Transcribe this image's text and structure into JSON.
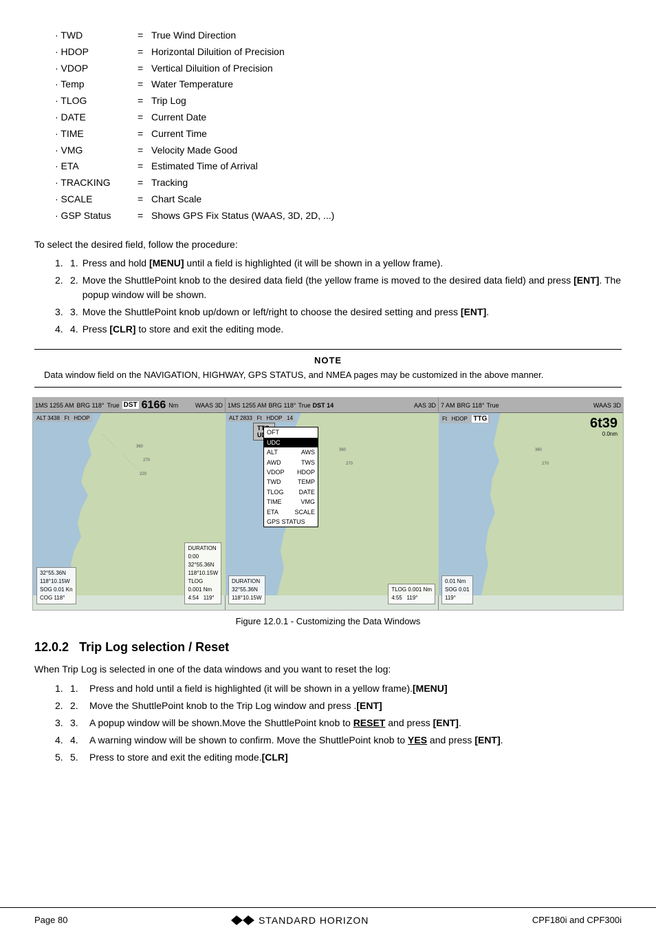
{
  "abbrevList": [
    {
      "key": "· TWD",
      "eq": "=",
      "val": "True Wind Direction"
    },
    {
      "key": "· HDOP",
      "eq": "=",
      "val": "Horizontal Diluition of Precision"
    },
    {
      "key": "· VDOP",
      "eq": "=",
      "val": "Vertical Diluition of Precision"
    },
    {
      "key": "· Temp",
      "eq": "=",
      "val": "Water Temperature"
    },
    {
      "key": "· TLOG",
      "eq": "=",
      "val": "Trip Log"
    },
    {
      "key": "· DATE",
      "eq": "=",
      "val": "Current Date"
    },
    {
      "key": "· TIME",
      "eq": "=",
      "val": "Current Time"
    },
    {
      "key": "· VMG",
      "eq": "=",
      "val": "Velocity Made Good"
    },
    {
      "key": "· ETA",
      "eq": "=",
      "val": "Estimated Time of Arrival"
    },
    {
      "key": "· TRACKING",
      "eq": "=",
      "val": "Tracking"
    },
    {
      "key": "· SCALE",
      "eq": "=",
      "val": "Chart Scale"
    },
    {
      "key": "· GSP Status",
      "eq": "=",
      "val": "Shows GPS Fix Status (WAAS, 3D, 2D, ...)"
    }
  ],
  "selectProcedureIntro": "To select the desired field, follow the procedure:",
  "selectProcedureSteps": [
    {
      "text": "Press and hold ",
      "bold": "[MENU]",
      "rest": " until a field is highlighted (it will be shown in a yellow frame)."
    },
    {
      "text": "Move the ShuttlePoint knob to the desired data field (the yellow frame is moved to the desired data field) and press ",
      "bold": "[ENT]",
      "rest": ". The popup window will be shown."
    },
    {
      "text": "Move the ShuttlePoint knob up/down or left/right to choose the desired setting and press ",
      "bold": "[ENT]",
      "rest": "."
    },
    {
      "text": "Press ",
      "bold": "[CLR]",
      "rest": " to store and exit the editing mode."
    }
  ],
  "noteTitle": "NOTE",
  "noteText": "Data window field on the NAVIGATION, HIGHWAY, GPS STATUS, and NMEA pages may be customized in the above manner.",
  "figureCaption": "Figure 12.0.1 - Customizing the Data Windows",
  "panelLeft": {
    "time": "1255 AM",
    "brg": "BRG 118°",
    "label": "True",
    "dst": "DST",
    "dstVal": "6166",
    "unit": "Nm",
    "waas": "WAAS 3D",
    "alt": "ALT 3438",
    "ft": "Ft",
    "hdop": "HDOP",
    "locationLine1": "32°55.36N",
    "locationLine2": "118°10.15W",
    "sog": "SOG",
    "sogVal": "0.01 Kn",
    "cog": "COG",
    "cogVal": "118°",
    "dur": "DURATION",
    "durVal": "0:00",
    "pos1": "32°55.36N",
    "pos2": "118°10.15W",
    "tlog": "TLOG",
    "tlogVal": "0.001 Nm",
    "pnt1": "4:54",
    "pnt2": "119°"
  },
  "panelMiddle": {
    "time": "1255 AM",
    "brg": "BRG 118°",
    "label": "True",
    "dst": "DST",
    "dstVal": "14",
    "alt": "ALT 2833",
    "ft": "Ft",
    "hdop": "HDOP",
    "waas": "AAS 3D",
    "popupRows": [
      {
        "left": "OFT",
        "right": "",
        "selected": false
      },
      {
        "left": "UDC",
        "right": "",
        "selected": true
      },
      {
        "left": "ALT",
        "right": "AWS",
        "selected": false
      },
      {
        "left": "AWD",
        "right": "TWS",
        "selected": false
      },
      {
        "left": "VDOP",
        "right": "HDOP",
        "selected": false
      },
      {
        "left": "TWD",
        "right": "TEMP",
        "selected": false
      },
      {
        "left": "TLOG",
        "right": "DATE",
        "selected": false
      },
      {
        "left": "TIME",
        "right": "VMG",
        "selected": false
      },
      {
        "left": "ETA",
        "right": "SCALE",
        "selected": false
      },
      {
        "left": "GPS STATUS",
        "right": "",
        "selected": false
      }
    ],
    "dur": "DURATION",
    "pos1": "32°55.36N",
    "pos2": "118°10.15W",
    "tlog": "TLOG",
    "tlogVal": "0.001 Nm",
    "pnt1": "4:55",
    "pnt2": "119°"
  },
  "panelRight": {
    "time": "7 AM",
    "brg": "BRG 118°",
    "label": "True",
    "waas": "WAAS 3D",
    "ttg": "TTG",
    "ttgVal": "6t39",
    "ft": "Ft",
    "hdop": "HDOP",
    "unit": "0.0nm",
    "sogVal": "SOG",
    "cog1": "0.01 Nm",
    "cog2": "119°"
  },
  "section": {
    "id": "12.0.2",
    "title": "Trip Log selection / Reset"
  },
  "tripLogIntro": "When Trip Log is selected in one of the data windows and you want to reset the log:",
  "tripLogSteps": [
    {
      "text": "Press and hold ",
      "bold": "[MENU]",
      "rest": " until a field is highlighted (it will be shown in a yellow frame)."
    },
    {
      "text": "Move the ShuttlePoint knob to the Trip Log window and press ",
      "bold": "[ENT]",
      "rest": "."
    },
    {
      "text": "A popup window will be shown.Move the ShuttlePoint knob to ",
      "bold_u": "RESET",
      "rest": " and press ",
      "bold": "[ENT]",
      "rest2": "."
    },
    {
      "text": "A warning window will be shown to confirm. Move the ShuttlePoint knob to ",
      "bold_u": "YES",
      "rest": " and press ",
      "bold": "[ENT]",
      "rest2": "."
    },
    {
      "text": "Press ",
      "bold": "[CLR]",
      "rest": " to store and exit the editing mode."
    }
  ],
  "footer": {
    "page": "Page  80",
    "logoText": "STANDARD  HORIZON",
    "model": "CPF180i and CPF300i"
  }
}
